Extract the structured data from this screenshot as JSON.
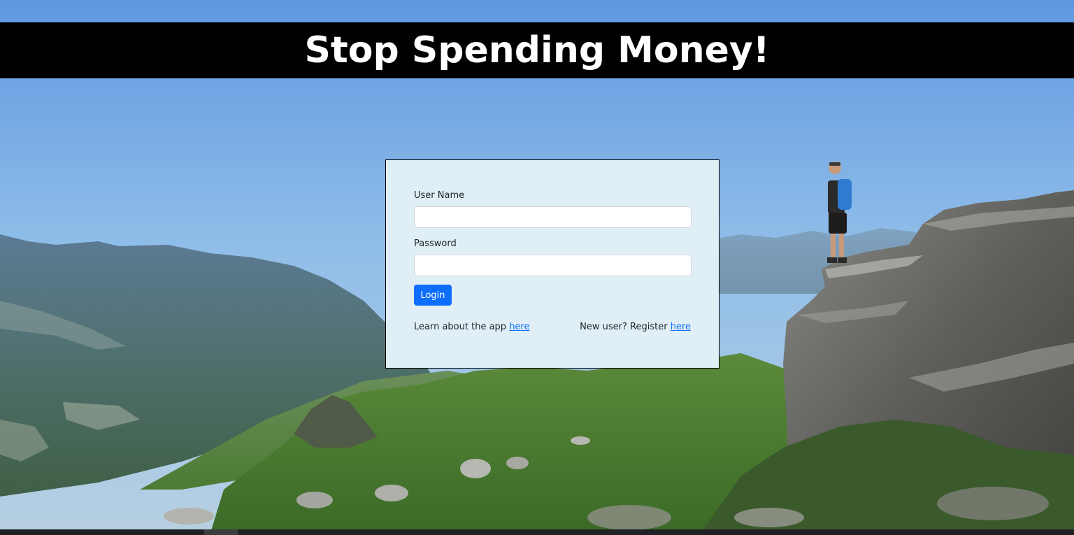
{
  "header": {
    "title": "Stop Spending Money!"
  },
  "login_form": {
    "username_label": "User Name",
    "username_value": "",
    "password_label": "Password",
    "password_value": "",
    "login_button_label": "Login",
    "learn_text": "Learn about the app ",
    "learn_link": "here",
    "register_text": "New user? Register ",
    "register_link": "here"
  },
  "colors": {
    "banner_background": "#000000",
    "card_background": "#e0eff6",
    "primary_button": "#0d6efd",
    "link": "#0d6efd"
  },
  "background": {
    "icon": "mountain-landscape-image"
  }
}
